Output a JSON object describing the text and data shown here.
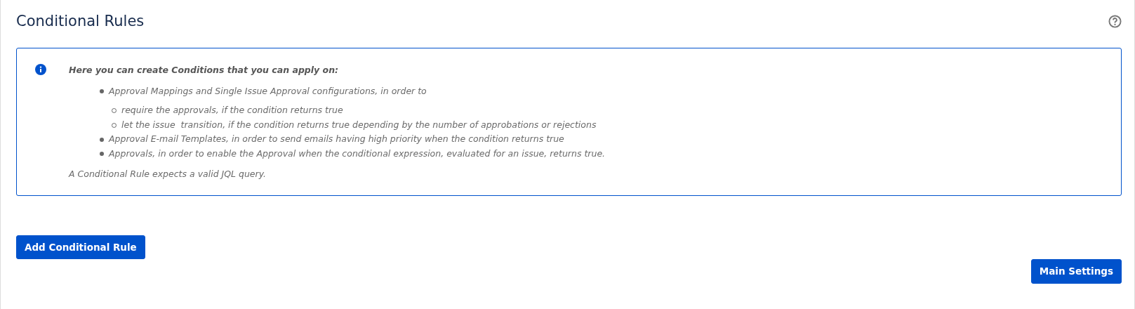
{
  "page": {
    "title": "Conditional Rules"
  },
  "info": {
    "heading": "Here you can create Conditions that you can apply on:",
    "items": [
      {
        "text": "Approval Mappings and Single Issue Approval configurations, in order to",
        "children": [
          {
            "text": "require the approvals, if the condition returns true"
          },
          {
            "text": "let the issue  transition, if the condition returns true depending by the number of approbations or rejections"
          }
        ]
      },
      {
        "text": "Approval E-mail Templates, in order to send emails having high priority when the condition returns true"
      },
      {
        "text": "Approvals, in order to enable the Approval when the conditional expression, evaluated for an issue, returns true."
      }
    ],
    "note": "A Conditional Rule expects a valid JQL query."
  },
  "buttons": {
    "add": "Add Conditional Rule",
    "settings": "Main Settings"
  }
}
